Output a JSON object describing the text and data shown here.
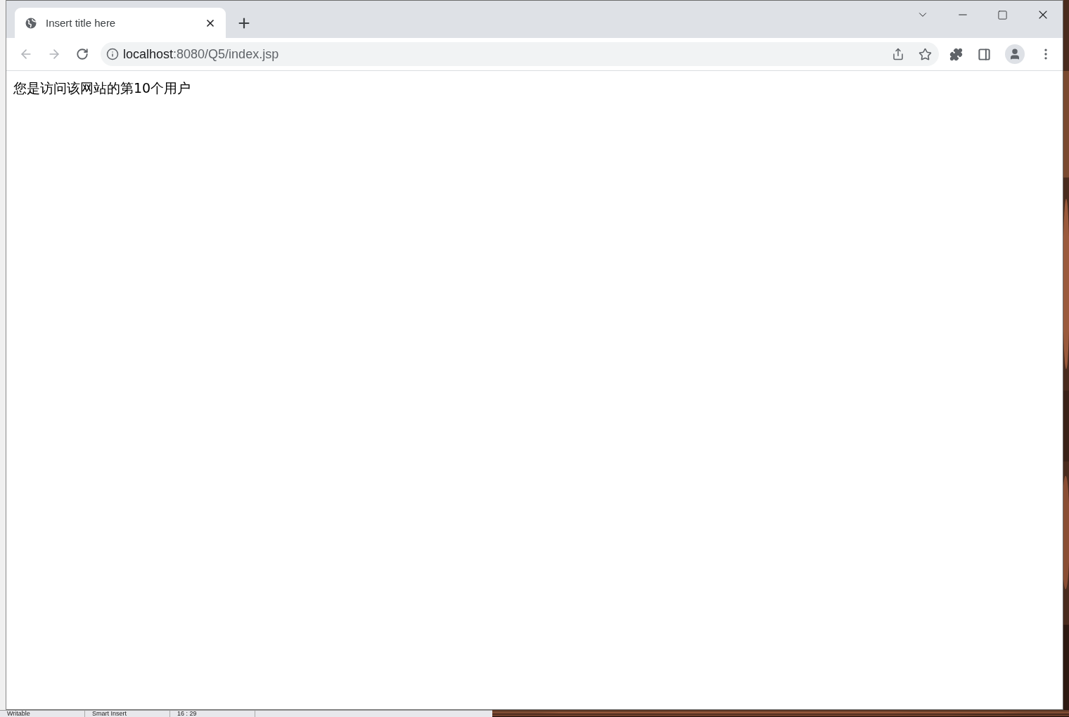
{
  "browser": {
    "tabs": [
      {
        "title": "Insert title here",
        "selected": true
      }
    ],
    "nav_buttons": [
      {
        "kind": "back",
        "disabled": true
      },
      {
        "kind": "forward",
        "disabled": true
      },
      {
        "kind": "reload",
        "disabled": false
      }
    ],
    "address": {
      "host": "localhost",
      "path": ":8080/Q5/index.jsp"
    }
  },
  "page": {
    "text": "您是访问该网站的第10个用户"
  },
  "ide_status_bar": {
    "items": [
      "Writable",
      "Smart Insert",
      "16 : 29"
    ]
  }
}
